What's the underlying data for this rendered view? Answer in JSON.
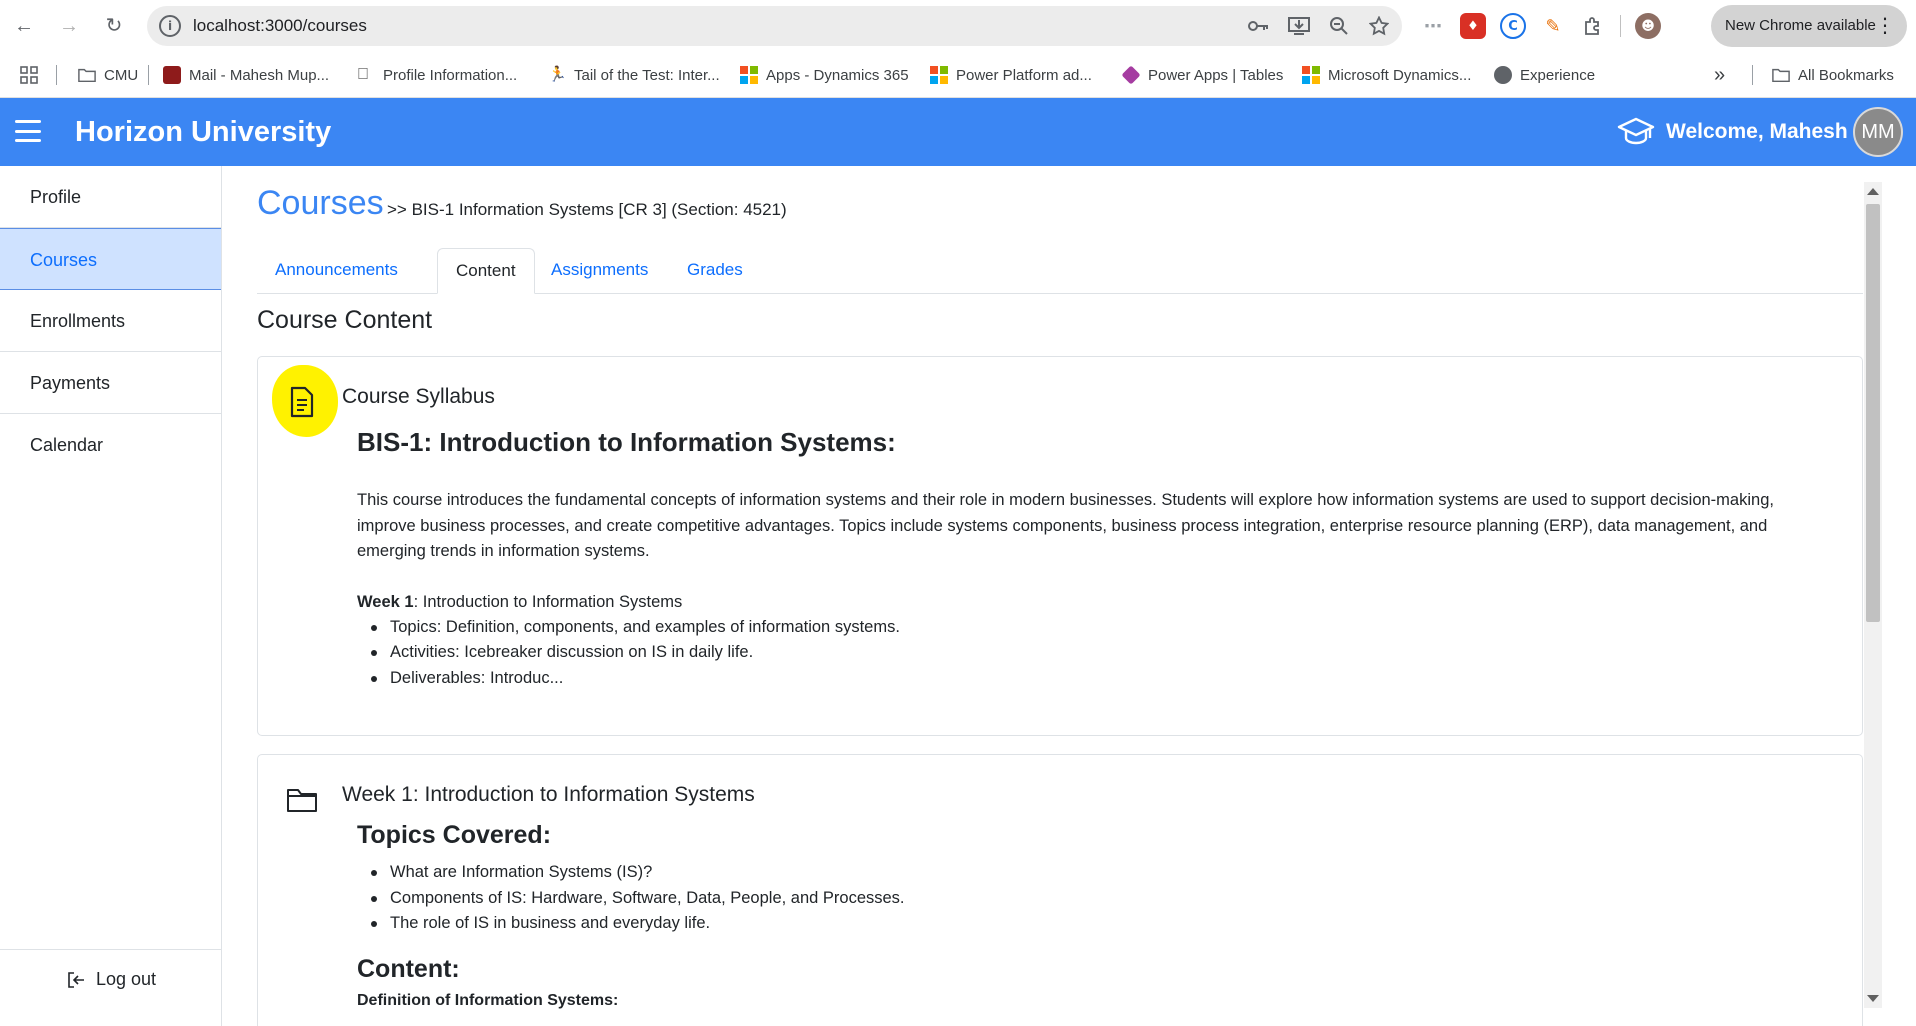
{
  "browser": {
    "url": "localhost:3000/courses",
    "new_chrome_label": "New Chrome available",
    "bookmarks": [
      {
        "label": "CMU"
      },
      {
        "label": "Mail - Mahesh Mup..."
      },
      {
        "label": "Profile Information..."
      },
      {
        "label": "Tail of the Test: Inter..."
      },
      {
        "label": "Apps - Dynamics 365"
      },
      {
        "label": "Power Platform ad..."
      },
      {
        "label": "Power Apps | Tables"
      },
      {
        "label": "Microsoft Dynamics..."
      },
      {
        "label": "Experience"
      }
    ],
    "all_bookmarks": "All Bookmarks"
  },
  "header": {
    "brand": "Horizon University",
    "welcome": "Welcome, Mahesh",
    "avatar_initials": "MM"
  },
  "sidebar": {
    "items": [
      {
        "label": "Profile"
      },
      {
        "label": "Courses"
      },
      {
        "label": "Enrollments"
      },
      {
        "label": "Payments"
      },
      {
        "label": "Calendar"
      }
    ],
    "logout": "Log out"
  },
  "main": {
    "title": "Courses",
    "breadcrumb": ">> BIS-1 Information Systems [CR 3] (Section: 4521)",
    "tabs": [
      {
        "label": "Announcements"
      },
      {
        "label": "Content"
      },
      {
        "label": "Assignments"
      },
      {
        "label": "Grades"
      }
    ],
    "section_title": "Course Content",
    "syllabus": {
      "title": "Course Syllabus",
      "heading": "BIS-1: Introduction to Information Systems:",
      "description": "This course introduces the fundamental concepts of information systems and their role in modern businesses. Students will explore how information systems are used to support decision-making, improve business processes, and create competitive advantages. Topics include systems components, business process integration, enterprise resource planning (ERP), data management, and emerging trends in information systems.",
      "week_label": "Week 1",
      "week_text": ": Introduction to Information Systems",
      "bullets": [
        "Topics: Definition, components, and examples of information systems.",
        "Activities: Icebreaker discussion on IS in daily life.",
        "Deliverables: Introduc..."
      ]
    },
    "week1": {
      "title": "Week 1: Introduction to Information Systems",
      "topics_heading": "Topics Covered:",
      "topics": [
        "What are Information Systems (IS)?",
        "Components of IS: Hardware, Software, Data, People, and Processes.",
        "The role of IS in business and everyday life."
      ],
      "content_heading": "Content:",
      "definition_heading": "Definition of Information Systems:"
    }
  }
}
